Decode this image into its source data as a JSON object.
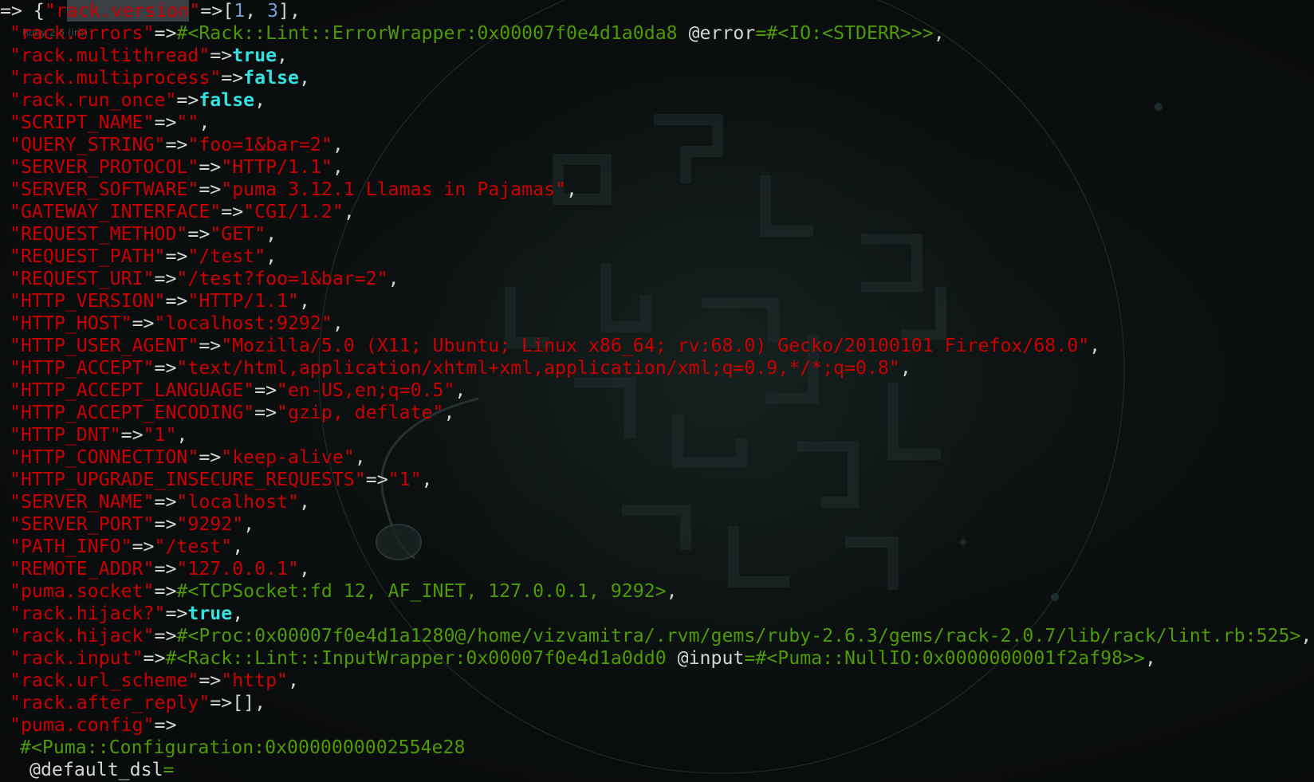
{
  "window": {
    "tab_hint": "Ruby 2.6 (irb)"
  },
  "colors": {
    "background": "#0b0d0e",
    "string": "#cc0000",
    "keyword": "#34e2e2",
    "number": "#729fcf",
    "object": "#4e9a06",
    "plain": "#d3d7cf"
  },
  "lines": [
    {
      "indent": 0,
      "segments": [
        {
          "t": "=> {",
          "c": "plain"
        },
        {
          "t": "\"r",
          "c": "str"
        },
        {
          "t": "ack.version",
          "c": "str",
          "sel": true
        },
        {
          "t": "\"",
          "c": "str"
        },
        {
          "t": "=>[",
          "c": "plain"
        },
        {
          "t": "1",
          "c": "num"
        },
        {
          "t": ", ",
          "c": "plain"
        },
        {
          "t": "3",
          "c": "num"
        },
        {
          "t": "],",
          "c": "plain"
        }
      ]
    },
    {
      "indent": 1,
      "segments": [
        {
          "t": "\"rack.errors\"",
          "c": "str"
        },
        {
          "t": "=>",
          "c": "plain"
        },
        {
          "t": "#<Rack::Lint::ErrorWrapper:0x00007f0e4d1a0da8 ",
          "c": "obj"
        },
        {
          "t": "@error",
          "c": "plain"
        },
        {
          "t": "=#<IO:<STDERR>>>",
          "c": "obj"
        },
        {
          "t": ",",
          "c": "plain"
        }
      ]
    },
    {
      "indent": 1,
      "segments": [
        {
          "t": "\"rack.multithread\"",
          "c": "str"
        },
        {
          "t": "=>",
          "c": "plain"
        },
        {
          "t": "true",
          "c": "kw"
        },
        {
          "t": ",",
          "c": "plain"
        }
      ]
    },
    {
      "indent": 1,
      "segments": [
        {
          "t": "\"rack.multiprocess\"",
          "c": "str"
        },
        {
          "t": "=>",
          "c": "plain"
        },
        {
          "t": "false",
          "c": "kw"
        },
        {
          "t": ",",
          "c": "plain"
        }
      ]
    },
    {
      "indent": 1,
      "segments": [
        {
          "t": "\"rack.run_once\"",
          "c": "str"
        },
        {
          "t": "=>",
          "c": "plain"
        },
        {
          "t": "false",
          "c": "kw"
        },
        {
          "t": ",",
          "c": "plain"
        }
      ]
    },
    {
      "indent": 1,
      "segments": [
        {
          "t": "\"SCRIPT_NAME\"",
          "c": "str"
        },
        {
          "t": "=>",
          "c": "plain"
        },
        {
          "t": "\"\"",
          "c": "str"
        },
        {
          "t": ",",
          "c": "plain"
        }
      ]
    },
    {
      "indent": 1,
      "segments": [
        {
          "t": "\"QUERY_STRING\"",
          "c": "str"
        },
        {
          "t": "=>",
          "c": "plain"
        },
        {
          "t": "\"foo=1&bar=2\"",
          "c": "str"
        },
        {
          "t": ",",
          "c": "plain"
        }
      ]
    },
    {
      "indent": 1,
      "segments": [
        {
          "t": "\"SERVER_PROTOCOL\"",
          "c": "str"
        },
        {
          "t": "=>",
          "c": "plain"
        },
        {
          "t": "\"HTTP/1.1\"",
          "c": "str"
        },
        {
          "t": ",",
          "c": "plain"
        }
      ]
    },
    {
      "indent": 1,
      "segments": [
        {
          "t": "\"SERVER_SOFTWARE\"",
          "c": "str"
        },
        {
          "t": "=>",
          "c": "plain"
        },
        {
          "t": "\"puma 3.12.1 Llamas in Pajamas\"",
          "c": "str"
        },
        {
          "t": ",",
          "c": "plain"
        }
      ]
    },
    {
      "indent": 1,
      "segments": [
        {
          "t": "\"GATEWAY_INTERFACE\"",
          "c": "str"
        },
        {
          "t": "=>",
          "c": "plain"
        },
        {
          "t": "\"CGI/1.2\"",
          "c": "str"
        },
        {
          "t": ",",
          "c": "plain"
        }
      ]
    },
    {
      "indent": 1,
      "segments": [
        {
          "t": "\"REQUEST_METHOD\"",
          "c": "str"
        },
        {
          "t": "=>",
          "c": "plain"
        },
        {
          "t": "\"GET\"",
          "c": "str"
        },
        {
          "t": ",",
          "c": "plain"
        }
      ]
    },
    {
      "indent": 1,
      "segments": [
        {
          "t": "\"REQUEST_PATH\"",
          "c": "str"
        },
        {
          "t": "=>",
          "c": "plain"
        },
        {
          "t": "\"/test\"",
          "c": "str"
        },
        {
          "t": ",",
          "c": "plain"
        }
      ]
    },
    {
      "indent": 1,
      "segments": [
        {
          "t": "\"REQUEST_URI\"",
          "c": "str"
        },
        {
          "t": "=>",
          "c": "plain"
        },
        {
          "t": "\"/test?foo=1&bar=2\"",
          "c": "str"
        },
        {
          "t": ",",
          "c": "plain"
        }
      ]
    },
    {
      "indent": 1,
      "segments": [
        {
          "t": "\"HTTP_VERSION\"",
          "c": "str"
        },
        {
          "t": "=>",
          "c": "plain"
        },
        {
          "t": "\"HTTP/1.1\"",
          "c": "str"
        },
        {
          "t": ",",
          "c": "plain"
        }
      ]
    },
    {
      "indent": 1,
      "segments": [
        {
          "t": "\"HTTP_HOST\"",
          "c": "str"
        },
        {
          "t": "=>",
          "c": "plain"
        },
        {
          "t": "\"localhost:9292\"",
          "c": "str"
        },
        {
          "t": ",",
          "c": "plain"
        }
      ]
    },
    {
      "indent": 1,
      "segments": [
        {
          "t": "\"HTTP_USER_AGENT\"",
          "c": "str"
        },
        {
          "t": "=>",
          "c": "plain"
        },
        {
          "t": "\"Mozilla/5.0 (X11; Ubuntu; Linux x86_64; rv:68.0) Gecko/20100101 Firefox/68.0\"",
          "c": "str"
        },
        {
          "t": ",",
          "c": "plain"
        }
      ]
    },
    {
      "indent": 1,
      "segments": [
        {
          "t": "\"HTTP_ACCEPT\"",
          "c": "str"
        },
        {
          "t": "=>",
          "c": "plain"
        },
        {
          "t": "\"text/html,application/xhtml+xml,application/xml;q=0.9,*/*;q=0.8\"",
          "c": "str"
        },
        {
          "t": ",",
          "c": "plain"
        }
      ]
    },
    {
      "indent": 1,
      "segments": [
        {
          "t": "\"HTTP_ACCEPT_LANGUAGE\"",
          "c": "str"
        },
        {
          "t": "=>",
          "c": "plain"
        },
        {
          "t": "\"en-US,en;q=0.5\"",
          "c": "str"
        },
        {
          "t": ",",
          "c": "plain"
        }
      ]
    },
    {
      "indent": 1,
      "segments": [
        {
          "t": "\"HTTP_ACCEPT_ENCODING\"",
          "c": "str"
        },
        {
          "t": "=>",
          "c": "plain"
        },
        {
          "t": "\"gzip, deflate\"",
          "c": "str"
        },
        {
          "t": ",",
          "c": "plain"
        }
      ]
    },
    {
      "indent": 1,
      "segments": [
        {
          "t": "\"HTTP_DNT\"",
          "c": "str"
        },
        {
          "t": "=>",
          "c": "plain"
        },
        {
          "t": "\"1\"",
          "c": "str"
        },
        {
          "t": ",",
          "c": "plain"
        }
      ]
    },
    {
      "indent": 1,
      "segments": [
        {
          "t": "\"HTTP_CONNECTION\"",
          "c": "str"
        },
        {
          "t": "=>",
          "c": "plain"
        },
        {
          "t": "\"keep-alive\"",
          "c": "str"
        },
        {
          "t": ",",
          "c": "plain"
        }
      ]
    },
    {
      "indent": 1,
      "segments": [
        {
          "t": "\"HTTP_UPGRADE_INSECURE_REQUESTS\"",
          "c": "str"
        },
        {
          "t": "=>",
          "c": "plain"
        },
        {
          "t": "\"1\"",
          "c": "str"
        },
        {
          "t": ",",
          "c": "plain"
        }
      ]
    },
    {
      "indent": 1,
      "segments": [
        {
          "t": "\"SERVER_NAME\"",
          "c": "str"
        },
        {
          "t": "=>",
          "c": "plain"
        },
        {
          "t": "\"localhost\"",
          "c": "str"
        },
        {
          "t": ",",
          "c": "plain"
        }
      ]
    },
    {
      "indent": 1,
      "segments": [
        {
          "t": "\"SERVER_PORT\"",
          "c": "str"
        },
        {
          "t": "=>",
          "c": "plain"
        },
        {
          "t": "\"9292\"",
          "c": "str"
        },
        {
          "t": ",",
          "c": "plain"
        }
      ]
    },
    {
      "indent": 1,
      "segments": [
        {
          "t": "\"PATH_INFO\"",
          "c": "str"
        },
        {
          "t": "=>",
          "c": "plain"
        },
        {
          "t": "\"/test\"",
          "c": "str"
        },
        {
          "t": ",",
          "c": "plain"
        }
      ]
    },
    {
      "indent": 1,
      "segments": [
        {
          "t": "\"REMOTE_ADDR\"",
          "c": "str"
        },
        {
          "t": "=>",
          "c": "plain"
        },
        {
          "t": "\"127.0.0.1\"",
          "c": "str"
        },
        {
          "t": ",",
          "c": "plain"
        }
      ]
    },
    {
      "indent": 1,
      "segments": [
        {
          "t": "\"puma.socket\"",
          "c": "str"
        },
        {
          "t": "=>",
          "c": "plain"
        },
        {
          "t": "#<TCPSocket:fd 12, AF_INET, 127.0.0.1, 9292>",
          "c": "obj"
        },
        {
          "t": ",",
          "c": "plain"
        }
      ]
    },
    {
      "indent": 1,
      "segments": [
        {
          "t": "\"rack.hijack?\"",
          "c": "str"
        },
        {
          "t": "=>",
          "c": "plain"
        },
        {
          "t": "true",
          "c": "kw"
        },
        {
          "t": ",",
          "c": "plain"
        }
      ]
    },
    {
      "indent": 1,
      "segments": [
        {
          "t": "\"rack.hijack\"",
          "c": "str"
        },
        {
          "t": "=>",
          "c": "plain"
        },
        {
          "t": "#<Proc:0x00007f0e4d1a1280@/home/vizvamitra/.rvm/gems/ruby-2.6.3/gems/rack-2.0.7/lib/rack/lint.rb:525>",
          "c": "obj"
        },
        {
          "t": ",",
          "c": "plain"
        }
      ]
    },
    {
      "indent": 1,
      "segments": [
        {
          "t": "\"rack.input\"",
          "c": "str"
        },
        {
          "t": "=>",
          "c": "plain"
        },
        {
          "t": "#<Rack::Lint::InputWrapper:0x00007f0e4d1a0dd0 ",
          "c": "obj"
        },
        {
          "t": "@input",
          "c": "plain"
        },
        {
          "t": "=#<Puma::NullIO:0x0000000001f2af98>>",
          "c": "obj"
        },
        {
          "t": ",",
          "c": "plain"
        }
      ]
    },
    {
      "indent": 1,
      "segments": [
        {
          "t": "\"rack.url_scheme\"",
          "c": "str"
        },
        {
          "t": "=>",
          "c": "plain"
        },
        {
          "t": "\"http\"",
          "c": "str"
        },
        {
          "t": ",",
          "c": "plain"
        }
      ]
    },
    {
      "indent": 1,
      "segments": [
        {
          "t": "\"rack.after_reply\"",
          "c": "str"
        },
        {
          "t": "=>[],",
          "c": "plain"
        }
      ]
    },
    {
      "indent": 1,
      "segments": [
        {
          "t": "\"puma.config\"",
          "c": "str"
        },
        {
          "t": "=>",
          "c": "plain"
        }
      ]
    },
    {
      "indent": 2,
      "segments": [
        {
          "t": "#<Puma::Configuration:0x0000000002554e28",
          "c": "obj"
        }
      ]
    },
    {
      "indent": 3,
      "segments": [
        {
          "t": "@default_dsl",
          "c": "plain"
        },
        {
          "t": "=",
          "c": "obj"
        }
      ]
    }
  ]
}
